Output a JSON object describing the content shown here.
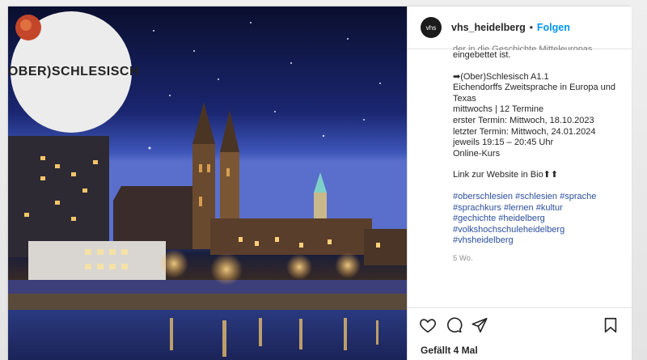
{
  "badge": {
    "text": "(OBER)SCHLESISCH"
  },
  "account": {
    "avatar_text": "vhs",
    "username": "vhs_heidelberg",
    "separator": "•",
    "follow_label": "Folgen"
  },
  "caption": {
    "truncated_line": "der in die Geschichte Mitteleuropas",
    "line0": "eingebettet ist.",
    "course_title": "➡(Ober)Schlesisch A1.1",
    "course_subtitle": "Eichendorffs Zweitsprache in Europa und Texas",
    "schedule": "mittwochs | 12 Termine",
    "first_date": "erster Termin: Mittwoch, 18.10.2023",
    "last_date": "letzter Termin: Mittwoch, 24.01.2024",
    "time": "jeweils 19:15 – 20:45 Uhr",
    "mode": "Online-Kurs",
    "link_text": "Link zur Website in Bio⬆⬆",
    "hashtags1": "#oberschlesien #schlesien #sprache",
    "hashtags2": "#sprachkurs #lernen #kultur",
    "hashtags3": "#gechichte #heidelberg",
    "hashtags4": "#volkshochschuleheidelberg",
    "hashtags5": "#vhsheidelberg",
    "posted": "5 Wo."
  },
  "actions": {
    "like_icon": "heart-icon",
    "comment_icon": "comment-icon",
    "share_icon": "share-icon",
    "save_icon": "bookmark-icon"
  },
  "likes": {
    "text": "Gefällt 4 Mal"
  }
}
